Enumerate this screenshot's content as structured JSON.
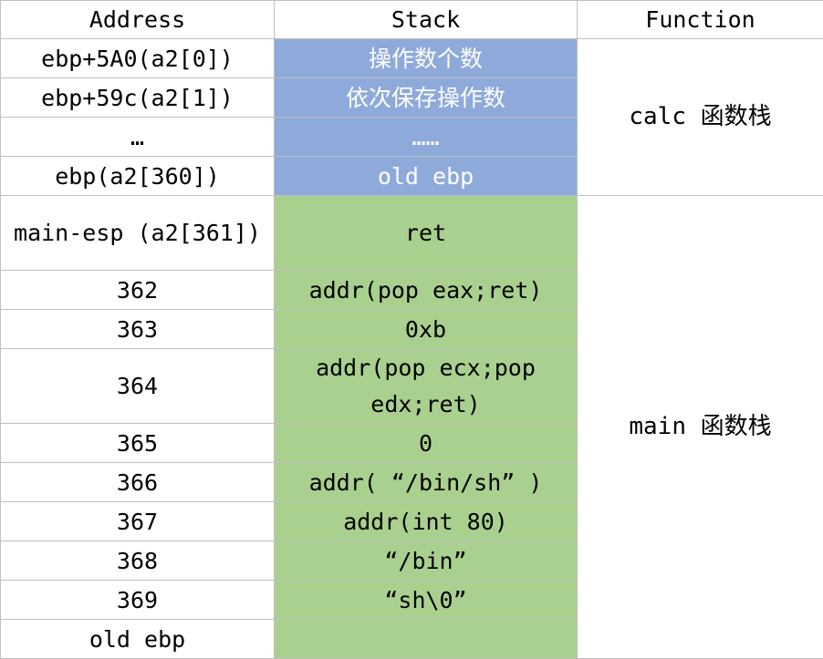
{
  "headers": {
    "address": "Address",
    "stack": "Stack",
    "function": "Function"
  },
  "calc_section": {
    "function_label": "calc 函数栈",
    "rows": [
      {
        "address": "ebp+5A0(a2[0])",
        "stack": "操作数个数"
      },
      {
        "address": "ebp+59c(a2[1])",
        "stack": "依次保存操作数"
      },
      {
        "address": "…",
        "stack": "……"
      },
      {
        "address": "ebp(a2[360])",
        "stack": "old ebp"
      }
    ]
  },
  "main_section": {
    "function_label": "main 函数栈",
    "rows": [
      {
        "address": "main-esp (a2[361])",
        "stack": "ret"
      },
      {
        "address": "362",
        "stack": "addr(pop eax;ret)"
      },
      {
        "address": "363",
        "stack": "0xb"
      },
      {
        "address": "364",
        "stack": "addr(pop ecx;pop edx;ret)"
      },
      {
        "address": "365",
        "stack": "0"
      },
      {
        "address": "366",
        "stack": "addr( “/bin/sh” )"
      },
      {
        "address": "367",
        "stack": "addr(int 80)"
      },
      {
        "address": "368",
        "stack": "“/bin”"
      },
      {
        "address": "369",
        "stack": "“sh\\0”"
      },
      {
        "address": "old ebp",
        "stack": ""
      }
    ]
  },
  "colors": {
    "calc_stack_fill": "#8eaadb",
    "main_stack_fill": "#a9d08e",
    "grid_line": "#bfbfbf"
  }
}
